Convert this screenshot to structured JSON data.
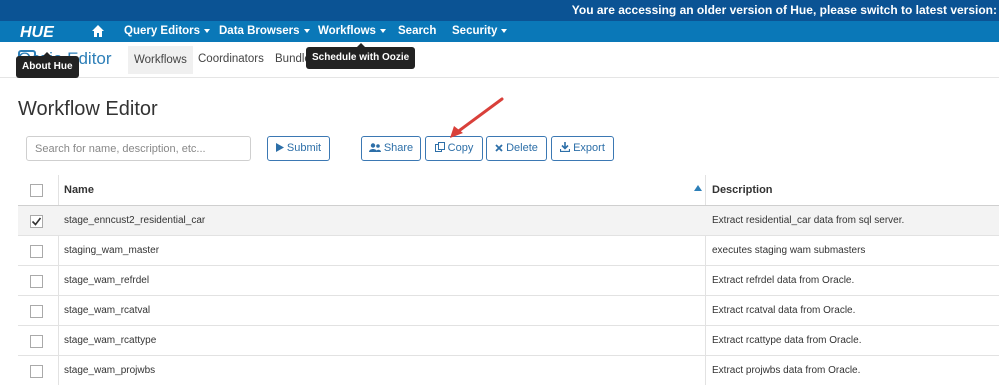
{
  "banner": {
    "text": "You are accessing an older version of Hue, please switch to latest version:"
  },
  "nav": {
    "logo": "HUE",
    "items": [
      {
        "label": "Query Editors"
      },
      {
        "label": "Data Browsers"
      },
      {
        "label": "Workflows"
      },
      {
        "label": "Search"
      },
      {
        "label": "Security"
      }
    ]
  },
  "subnav": {
    "app_title": "Oozie Editor",
    "tabs": [
      {
        "label": "Workflows"
      },
      {
        "label": "Coordinators"
      },
      {
        "label": "Bundles"
      }
    ]
  },
  "tooltips": {
    "about": "About Hue",
    "schedule": "Schedule with Oozie"
  },
  "page_title": "Workflow Editor",
  "toolbar": {
    "search_placeholder": "Search for name, description, etc...",
    "submit": "Submit",
    "share": "Share",
    "copy": "Copy",
    "delete": "Delete",
    "export": "Export"
  },
  "table": {
    "headers": {
      "name": "Name",
      "description": "Description"
    },
    "rows": [
      {
        "name": "stage_enncust2_residential_car",
        "description": "Extract residential_car data from sql server.",
        "checked": true
      },
      {
        "name": "staging_wam_master",
        "description": "executes staging wam submasters",
        "checked": false
      },
      {
        "name": "stage_wam_refrdel",
        "description": "Extract refrdel data from Oracle.",
        "checked": false
      },
      {
        "name": "stage_wam_rcatval",
        "description": "Extract rcatval data from Oracle.",
        "checked": false
      },
      {
        "name": "stage_wam_rcattype",
        "description": "Extract rcattype data from Oracle.",
        "checked": false
      },
      {
        "name": "stage_wam_projwbs",
        "description": "Extract projwbs data from Oracle.",
        "checked": false
      }
    ]
  },
  "colors": {
    "banner": "#0b5394",
    "navbar": "#0a78b8",
    "accent": "#2d7fb8",
    "annotation_arrow": "#d9403a"
  }
}
